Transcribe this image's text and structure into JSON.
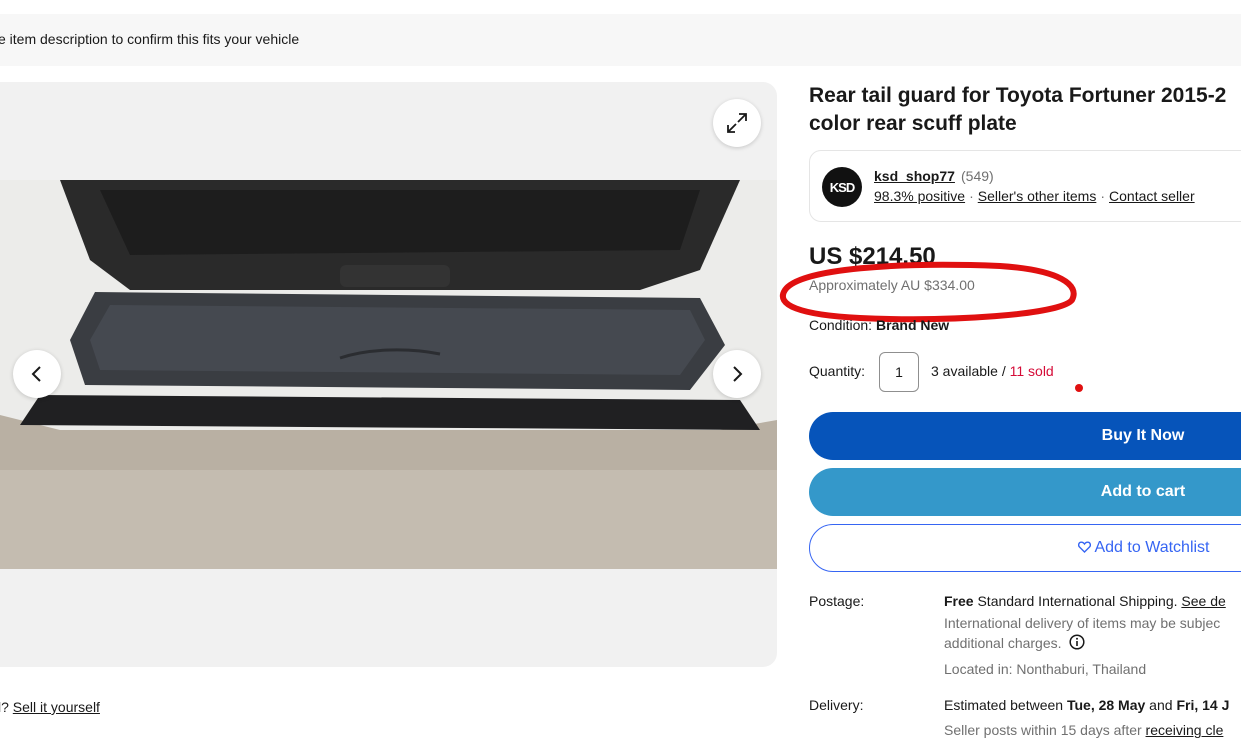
{
  "fitment": {
    "notice": "e item description to confirm this fits your vehicle"
  },
  "gallery": {
    "expand_icon": "expand-icon",
    "prev_icon": "chevron-left-icon",
    "next_icon": "chevron-right-icon"
  },
  "listing": {
    "title_line1": "Rear tail guard for Toyota Fortuner 2015-2",
    "title_line2": "color rear scuff plate"
  },
  "seller": {
    "logo_text": "KSD",
    "name": "ksd_shop77",
    "feedback_count": "(549)",
    "positive": "98.3% positive",
    "other_items": "Seller's other items",
    "contact": "Contact seller"
  },
  "pricing": {
    "price": "US $214.50",
    "approx": "Approximately AU $334.00"
  },
  "condition": {
    "label": "Condition:",
    "value": "Brand New"
  },
  "quantity": {
    "label": "Quantity:",
    "value": "1",
    "available": "3 available / ",
    "sold": "11 sold"
  },
  "actions": {
    "buy_now": "Buy It Now",
    "add_to_cart": "Add to cart",
    "watchlist": "Add to Watchlist"
  },
  "postage": {
    "label": "Postage:",
    "free": "Free",
    "shipping": " Standard International Shipping. ",
    "see_details": "See de",
    "intl_line1": "International delivery of items may be subjec",
    "intl_line2": "additional charges.",
    "located": "Located in: Nonthaburi, Thailand"
  },
  "delivery": {
    "label": "Delivery:",
    "estimated_prefix": "Estimated between ",
    "date1": "Tue, 28 May",
    "and": " and ",
    "date2": "Fri, 14 J",
    "posts_prefix": "Seller posts within 15 days after ",
    "receiving": "receiving cle"
  },
  "sell": {
    "prefix": "l? ",
    "link": "Sell it yourself"
  },
  "colors": {
    "buy_now": "#0654ba",
    "add_to_cart": "#3498ca",
    "watchlist": "#3665f3",
    "sold": "#d50b37",
    "annotation": "#e01010"
  }
}
